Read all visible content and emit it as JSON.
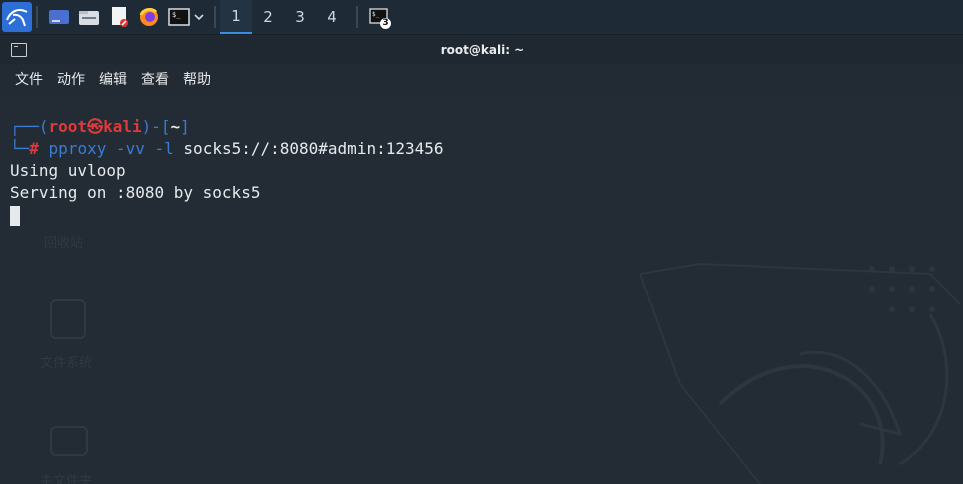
{
  "taskbar": {
    "workspaces": [
      "1",
      "2",
      "3",
      "4"
    ],
    "active_workspace": "1",
    "terminal_badge": "3",
    "accent": "#3b8de0"
  },
  "window": {
    "title": "root@kali: ~"
  },
  "menu": [
    "文件",
    "动作",
    "编辑",
    "查看",
    "帮助"
  ],
  "terminal": {
    "prompt_open": "┌──(",
    "user": "root",
    "at": "㉿",
    "host": "kali",
    "prompt_mid": ")-[",
    "cwd": "~",
    "prompt_close": "]",
    "prompt_2": "└─",
    "hash": "#",
    "command": "pproxy",
    "args": "-vv -l",
    "target": "socks5://:8080#admin:123456",
    "output": [
      "Using uvloop",
      "Serving on :8080 by socks5"
    ]
  },
  "desktop_ghost": [
    "回收站",
    "文件系统",
    "主文件夹"
  ]
}
